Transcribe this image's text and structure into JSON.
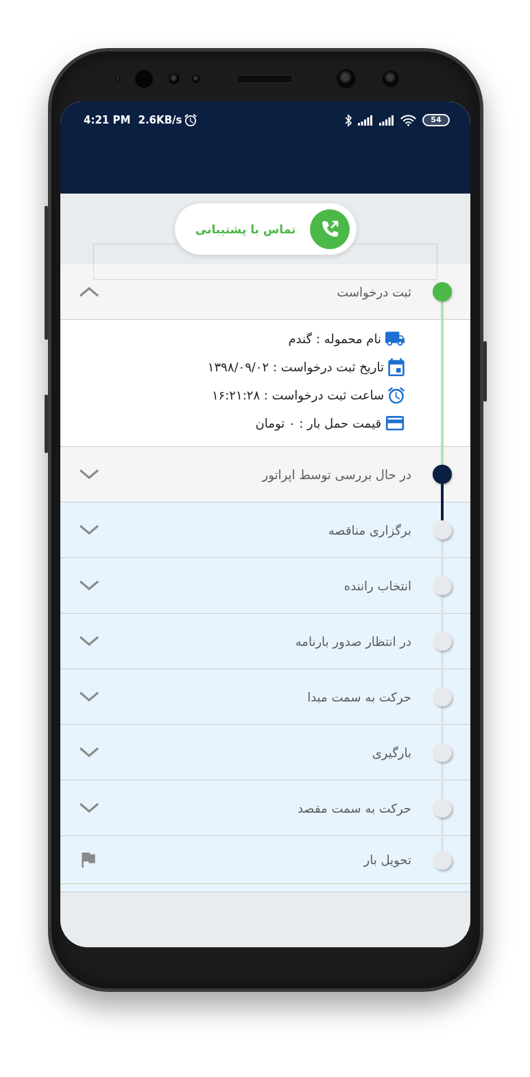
{
  "status_bar": {
    "time": "4:21 PM",
    "network_speed": "2.6KB/s",
    "battery": "54"
  },
  "support_button": {
    "label": "تماس با پشتیبانی"
  },
  "steps": [
    {
      "kind": "expandable",
      "title": "ثبت درخواست",
      "completed": true,
      "active": false,
      "expanded": true,
      "details": [
        {
          "kind": "truck",
          "text": "نام محموله : گندم"
        },
        {
          "kind": "calendar",
          "text": "تاریخ ثبت درخواست : ۱۳۹۸/۰۹/۰۲"
        },
        {
          "kind": "clock",
          "text": "ساعت ثبت درخواست : ۱۶:۲۱:۲۸"
        },
        {
          "kind": "card",
          "text": "قیمت حمل بار : ۰ تومان"
        }
      ]
    },
    {
      "kind": "expandable",
      "title": "در حال بررسی توسط اپراتور",
      "completed": false,
      "active": true,
      "expanded": false
    },
    {
      "kind": "expandable",
      "title": "برگزاری مناقصه",
      "completed": false,
      "active": false,
      "expanded": false
    },
    {
      "kind": "expandable",
      "title": "انتخاب راننده",
      "completed": false,
      "active": false,
      "expanded": false
    },
    {
      "kind": "expandable",
      "title": "در انتظار صدور بارنامه",
      "completed": false,
      "active": false,
      "expanded": false
    },
    {
      "kind": "expandable",
      "title": "حرکت به سمت مبدا",
      "completed": false,
      "active": false,
      "expanded": false
    },
    {
      "kind": "expandable",
      "title": "بارگیری",
      "completed": false,
      "active": false,
      "expanded": false
    },
    {
      "kind": "expandable",
      "title": "حرکت به سمت مقصد",
      "completed": false,
      "active": false,
      "expanded": false
    },
    {
      "kind": "final",
      "title": "تحویل بار",
      "completed": false,
      "active": false
    }
  ]
}
